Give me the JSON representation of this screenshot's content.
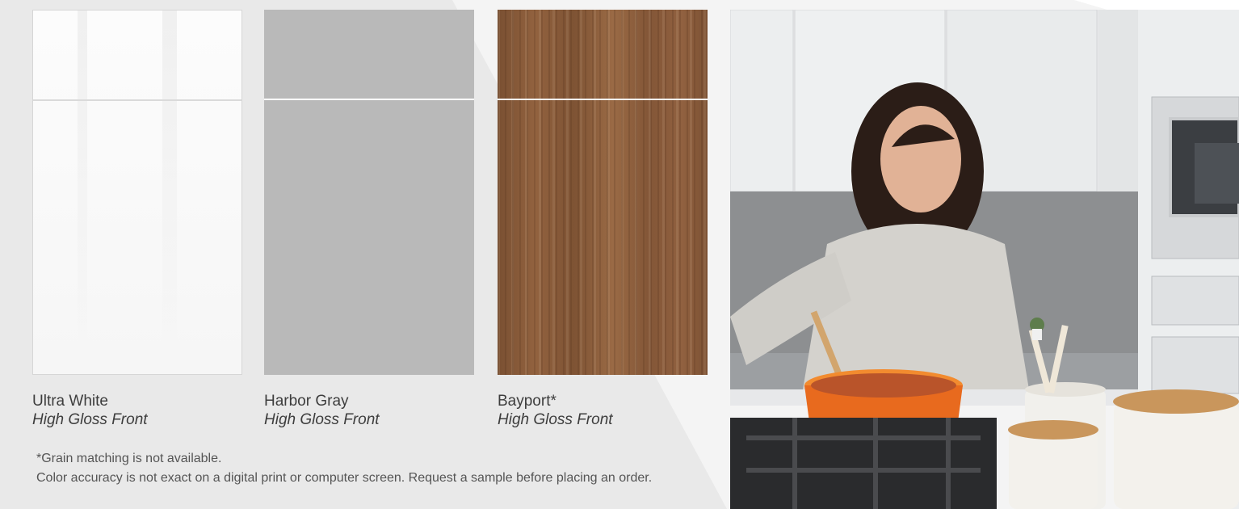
{
  "swatches": [
    {
      "name": "Ultra White",
      "finish": "High Gloss Front",
      "color": "#f8f8f8"
    },
    {
      "name": "Harbor Gray",
      "finish": "High Gloss Front",
      "color": "#b9b9b9"
    },
    {
      "name": "Bayport*",
      "finish": "High Gloss Front",
      "color": "#8a5c3b"
    }
  ],
  "notes": {
    "grain": "*Grain matching is not available.",
    "accuracy": "Color accuracy is not exact on a digital print or computer screen. Request a sample before placing an order."
  }
}
